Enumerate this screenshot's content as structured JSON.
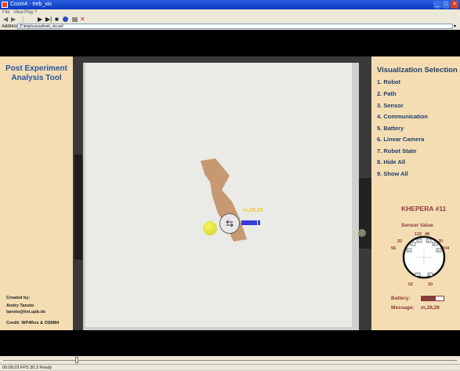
{
  "window": {
    "title": "Cosm4 - treb_vis",
    "minimize": "_",
    "maximize": "□",
    "close": "×"
  },
  "menu": [
    "File",
    "View",
    "Play",
    "?"
  ],
  "toolbar": {
    "back": "◀",
    "forward": "▶",
    "play": "▶",
    "skip": "▶|",
    "stop": "■"
  },
  "address": {
    "label": "Address",
    "value": "Z:\\tmp\\cocoa\\treb_vis.wrl"
  },
  "left_panel": {
    "title": "Post Experiment Analysis Tool",
    "created_by_label": "Created by:",
    "author": "Andry Tanoto",
    "email": "tanoto@hni.upb.de",
    "credit": "Credit:  WP4Rox & OSM84"
  },
  "arena": {
    "robot_label": "m,28,28",
    "robot_symbol": "⇆",
    "trail_color": "#c4956c"
  },
  "visualization": {
    "title": "Visualization Selection",
    "items": [
      "1.  Robot",
      "2.  Path",
      "3.  Sensor",
      "4.  Communication",
      "5.  Battery",
      "6.  Linear Camera",
      "7.  Robot State",
      "8.  Hide All",
      "9.  Show All"
    ]
  },
  "robot_info": {
    "name": "KHEPERA  #11",
    "sensor_title": "Sensor Value",
    "sensor_values": {
      "front_left": "132",
      "front_right": "48",
      "left_top": "20",
      "right_top": "20",
      "left": "56",
      "right": "104",
      "back_left": "52",
      "back_right": "20"
    },
    "sensor_numbers": [
      "0",
      "1",
      "2",
      "3",
      "4",
      "5",
      "6",
      "7"
    ],
    "battery_label": "Battery:",
    "battery_level": 0.65,
    "message_label": "Message:",
    "message_value": "m,28,28"
  },
  "status": {
    "text": "00:08.03  FPS 30.3   Ready",
    "seek_position": 0.16
  },
  "colors": {
    "panel_bg": "#f5ddb3",
    "title_blue": "#27569f",
    "accent_red": "#8a3a3a"
  }
}
